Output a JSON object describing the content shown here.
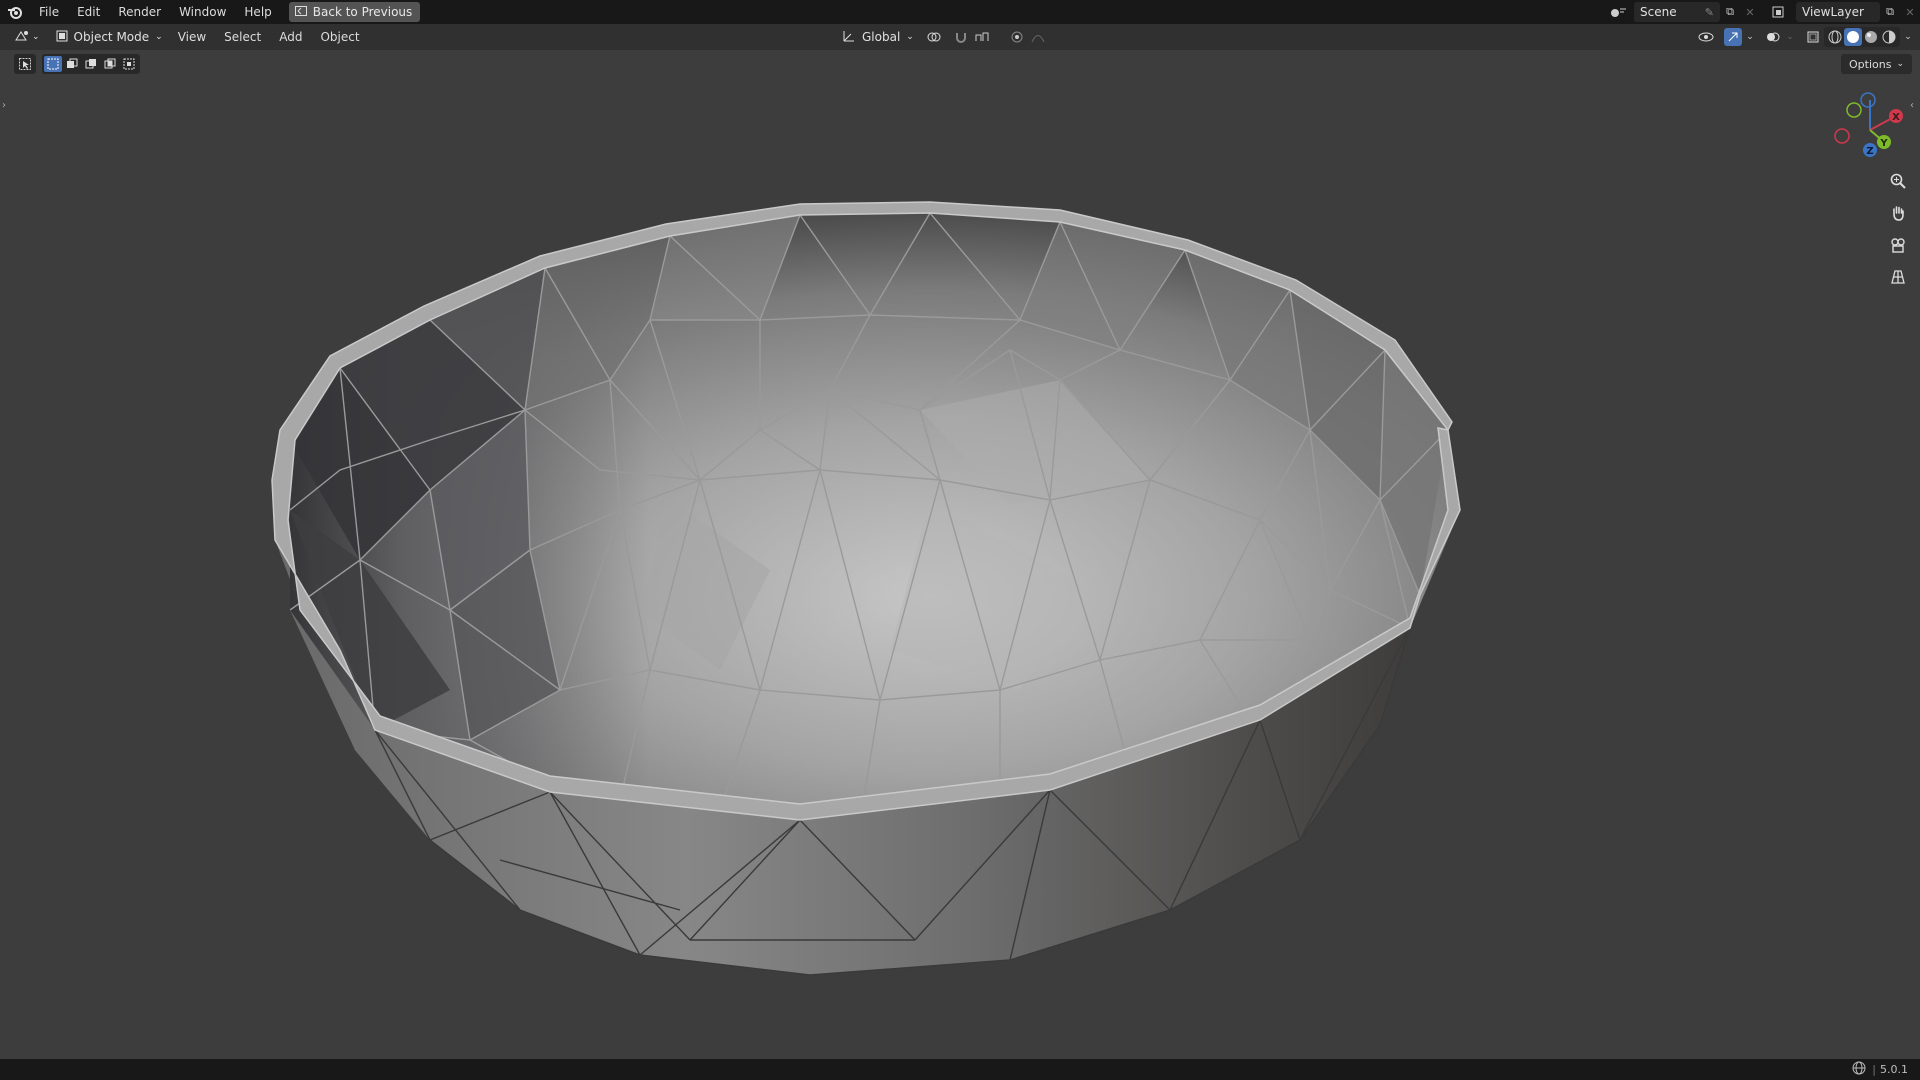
{
  "menu": {
    "items": [
      "File",
      "Edit",
      "Render",
      "Window",
      "Help"
    ],
    "back_label": "Back to Previous"
  },
  "scene": {
    "name": "Scene"
  },
  "view_layer": {
    "name": "ViewLayer"
  },
  "header": {
    "mode_label": "Object Mode",
    "menus": [
      "View",
      "Select",
      "Add",
      "Object"
    ],
    "transform_orientation": "Global"
  },
  "options_label": "Options",
  "gizmo": {
    "x_label": "X",
    "y_label": "Y",
    "z_label": "Z"
  },
  "status": {
    "version": "5.0.1"
  },
  "colors": {
    "accent": "#4772b3",
    "axis_x": "#d0384c",
    "axis_y": "#7fba2b",
    "axis_z": "#3b74c5"
  }
}
